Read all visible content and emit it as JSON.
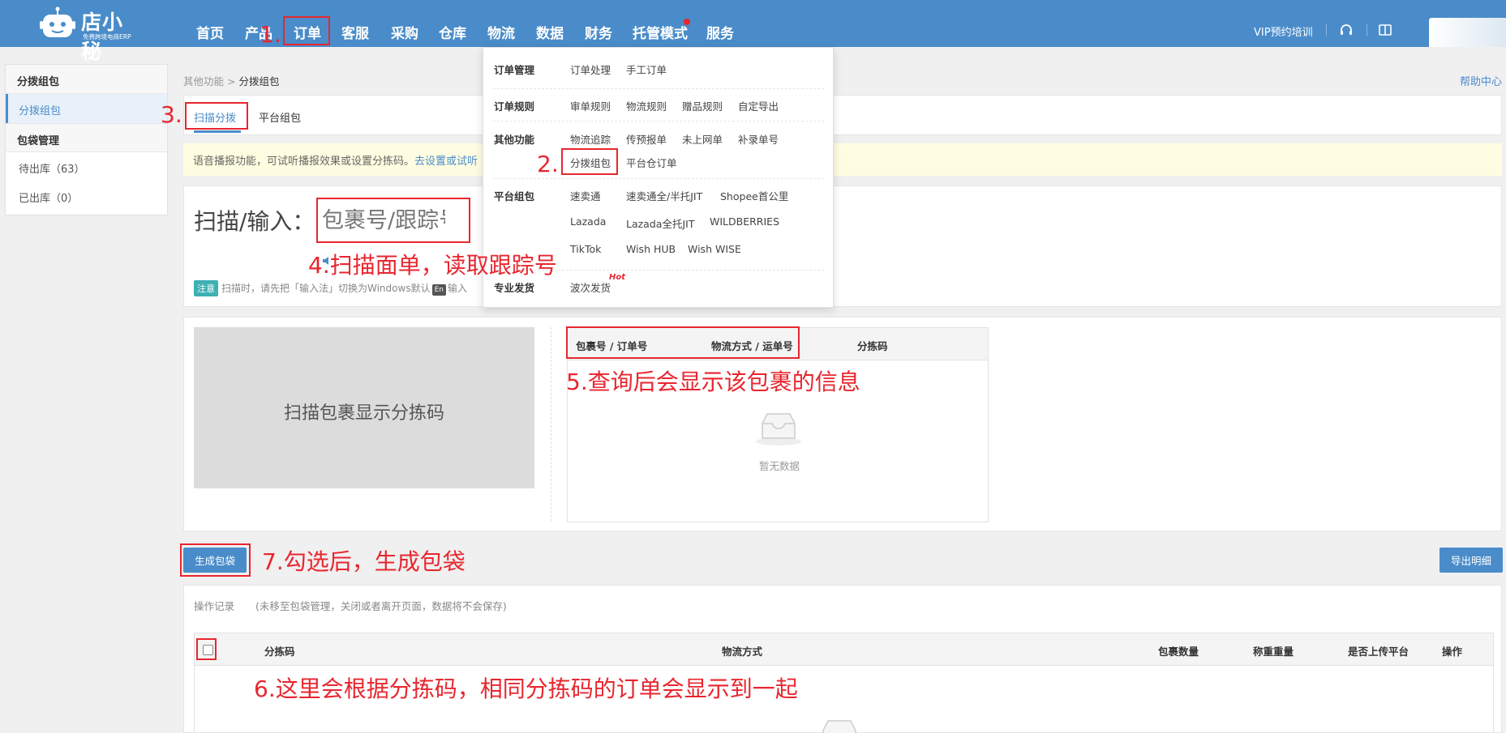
{
  "header": {
    "logo_name": "店小秘",
    "logo_sub": "免费跨境电商ERP",
    "nav": [
      "首页",
      "产品",
      "订单",
      "客服",
      "采购",
      "仓库",
      "物流",
      "数据",
      "财务",
      "托管模式",
      "服务"
    ],
    "vip_label": "VIP预约培训",
    "icons": [
      "headset-icon",
      "book-icon"
    ]
  },
  "sidebar": {
    "group1": "分拨组包",
    "item_active": "分拨组包",
    "group2": "包袋管理",
    "item2": "待出库（63）",
    "item3": "已出库（0）"
  },
  "breadcrumb": {
    "parent": "其他功能",
    "separator": ">",
    "current": "分拨组包"
  },
  "help_link": "帮助中心",
  "tabs": {
    "scan": "扫描分拨",
    "platform": "平台组包"
  },
  "notice": {
    "text": "语音播报功能，可试听播报效果或设置分拣码。",
    "link": "去设置或试听"
  },
  "scan": {
    "label": "扫描/输入：",
    "placeholder": "包裹号/跟踪号",
    "note_badge": "注意",
    "note_text": "扫描时，请先把「输入法」切换为Windows默认",
    "note_key": "En",
    "note_tail": "输入"
  },
  "result": {
    "sort_box_text": "扫描包裹显示分拣码",
    "headers": [
      "包裹号 / 订单号",
      "物流方式 / 运单号",
      "分拣码"
    ],
    "empty_text": "暂无数据"
  },
  "buttons": {
    "generate": "生成包袋",
    "export": "导出明细"
  },
  "records": {
    "title": "操作记录",
    "subtitle": "(未移至包袋管理，关闭或者离开页面，数据将不会保存)",
    "headers": [
      "分拣码",
      "物流方式",
      "包裹数量",
      "称重重量",
      "是否上传平台",
      "操作"
    ]
  },
  "dropdown": {
    "rows": [
      {
        "category": "订单管理",
        "links": [
          "订单处理",
          "手工订单"
        ]
      },
      {
        "category": "订单规则",
        "links": [
          "审单规则",
          "物流规则",
          "赠品规则",
          "自定导出"
        ]
      },
      {
        "category": "其他功能",
        "links": [
          "物流追踪",
          "传预报单",
          "未上网单",
          "补录单号",
          "分拨组包",
          "平台仓订单"
        ]
      },
      {
        "category": "平台组包",
        "links": [
          "速卖通",
          "速卖通全/半托JIT",
          "Shopee首公里",
          "Lazada",
          "Lazada全托JIT",
          "WILDBERRIES",
          "TikTok",
          "Wish HUB",
          "Wish WISE"
        ]
      },
      {
        "category": "专业发货",
        "links": [
          "波次发货"
        ],
        "hot": "Hot"
      }
    ]
  },
  "annotations": {
    "step1": "1.",
    "step2": "2.",
    "step3": "3.",
    "step4": "4.扫描面单，读取跟踪号",
    "step5": "5.查询后会显示该包裹的信息",
    "step6": "6.这里会根据分拣码，相同分拣码的订单会显示到一起",
    "step7": "7.勾选后，生成包袋"
  },
  "colors": {
    "brand": "#4a8cca",
    "annotation": "#e8262f",
    "notice_bg": "#fffde1"
  }
}
